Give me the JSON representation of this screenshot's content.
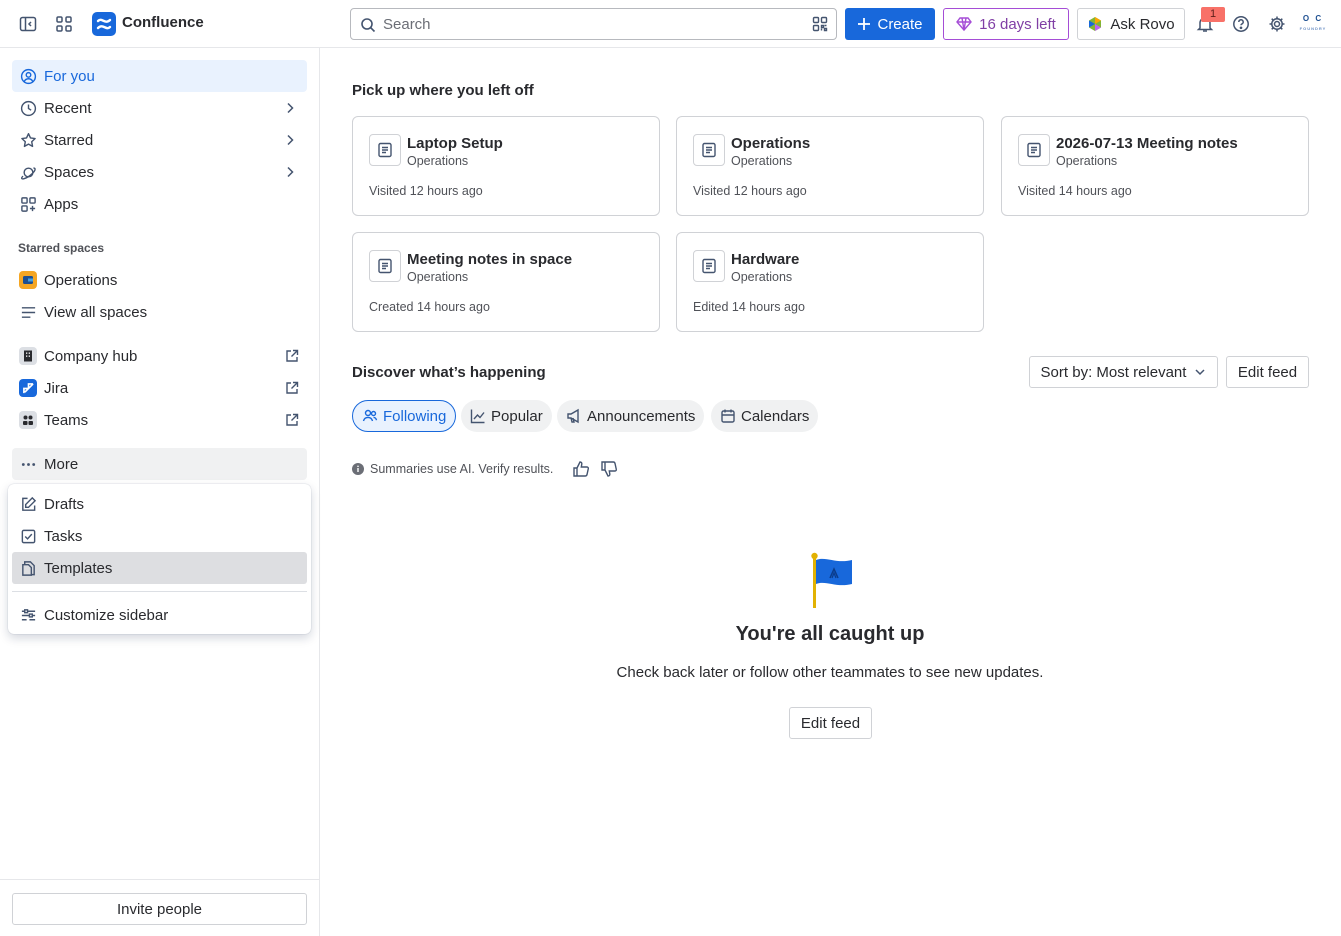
{
  "app": {
    "name": "Confluence"
  },
  "topbar": {
    "search_placeholder": "Search",
    "create_label": "Create",
    "trial_label": "16 days left",
    "rovo_label": "Ask Rovo",
    "notification_count": "1",
    "avatar_text": "O C",
    "avatar_sub": "FOUNDRY"
  },
  "sidebar": {
    "nav": [
      {
        "label": "For you",
        "icon": "user-circle-icon"
      },
      {
        "label": "Recent",
        "icon": "clock-icon"
      },
      {
        "label": "Starred",
        "icon": "star-icon"
      },
      {
        "label": "Spaces",
        "icon": "planet-icon"
      },
      {
        "label": "Apps",
        "icon": "apps-icon"
      }
    ],
    "starred_spaces_title": "Starred spaces",
    "spaces": [
      {
        "label": "Operations",
        "icon": "operations-space-icon"
      },
      {
        "label": "View all spaces",
        "icon": "list-icon"
      }
    ],
    "links": [
      {
        "label": "Company hub",
        "icon": "building-icon"
      },
      {
        "label": "Jira",
        "icon": "jira-icon"
      },
      {
        "label": "Teams",
        "icon": "teams-icon"
      }
    ],
    "more_label": "More",
    "more_menu": [
      {
        "label": "Drafts",
        "icon": "edit-icon"
      },
      {
        "label": "Tasks",
        "icon": "checkbox-icon"
      },
      {
        "label": "Templates",
        "icon": "template-icon"
      },
      {
        "label": "Customize sidebar",
        "icon": "customize-icon"
      }
    ],
    "invite_label": "Invite people"
  },
  "main": {
    "recent_title": "Pick up where you left off",
    "cards": [
      {
        "title": "Laptop Setup",
        "space": "Operations",
        "meta": "Visited 12 hours ago"
      },
      {
        "title": "Operations",
        "space": "Operations",
        "meta": "Visited 12 hours ago"
      },
      {
        "title": "2026-07-13 Meeting notes",
        "space": "Operations",
        "meta": "Visited 14 hours ago"
      },
      {
        "title": "Meeting notes in space",
        "space": "Operations",
        "meta": "Created 14 hours ago"
      },
      {
        "title": "Hardware",
        "space": "Operations",
        "meta": "Edited 14 hours ago"
      }
    ],
    "discover_title": "Discover what’s happening",
    "sort_label": "Sort by: Most relevant",
    "edit_feed_label": "Edit feed",
    "chips": [
      {
        "label": "Following",
        "selected": true
      },
      {
        "label": "Popular",
        "selected": false
      },
      {
        "label": "Announcements",
        "selected": false
      },
      {
        "label": "Calendars",
        "selected": false
      }
    ],
    "ai_note": "Summaries use AI. Verify results.",
    "empty_title": "You're all caught up",
    "empty_subtitle": "Check back later or follow other teammates to see new updates.",
    "empty_button": "Edit feed"
  },
  "colors": {
    "brand": "#1868db",
    "active_bg": "#e9f2fe",
    "trial": "#a54dd6",
    "badge": "#f87168",
    "flag": "#1868db",
    "pole": "#e2b203"
  }
}
